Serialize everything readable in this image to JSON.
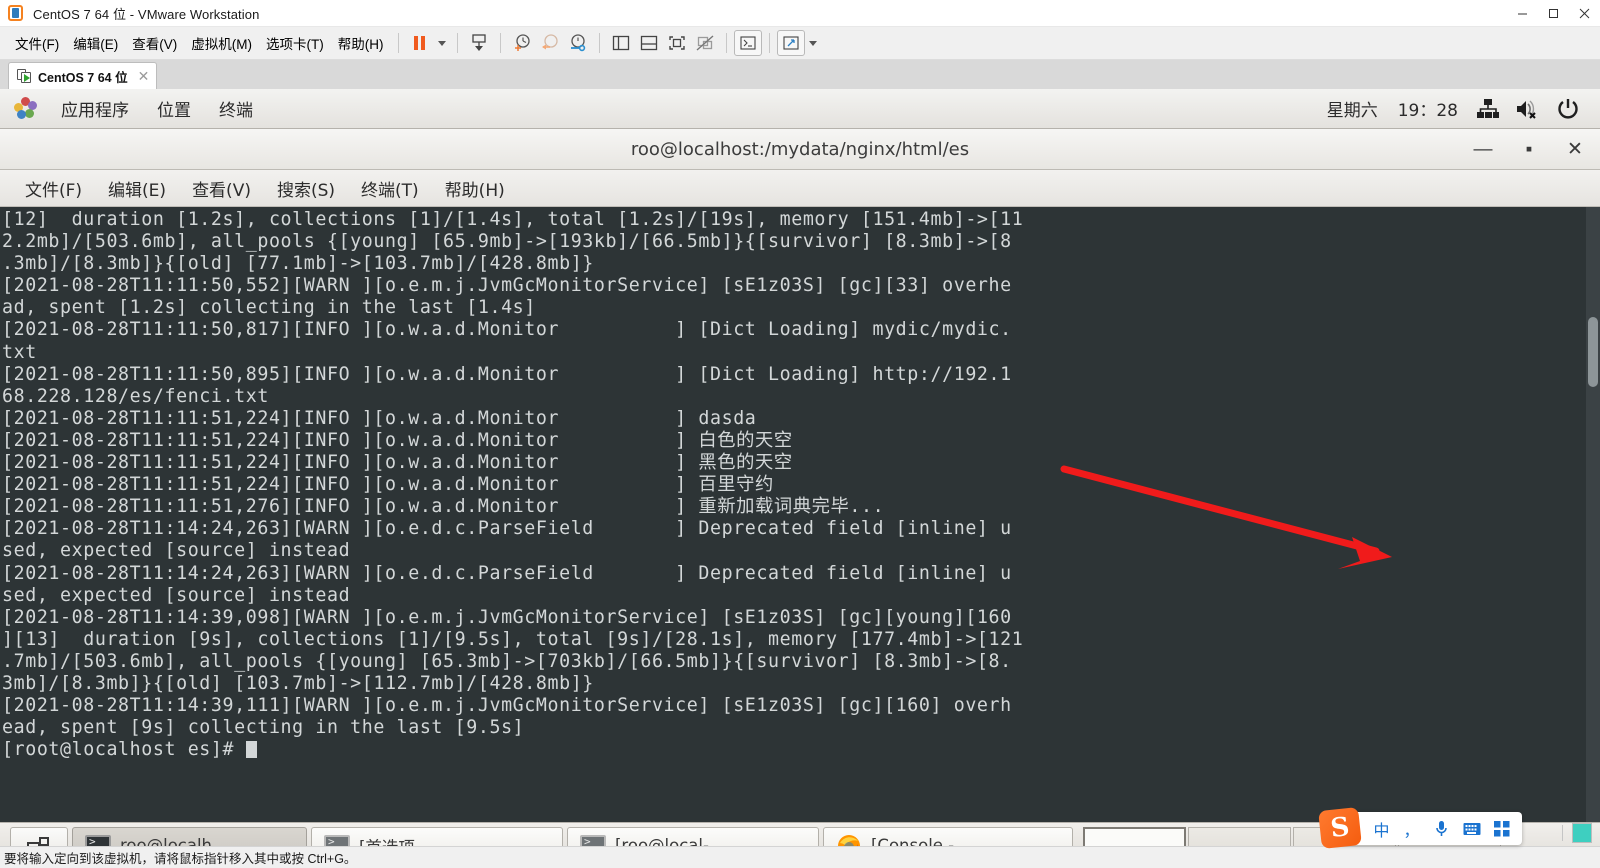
{
  "host": {
    "title": "CentOS 7 64 位 - VMware Workstation",
    "window_controls": {
      "minimize": "–",
      "maximize": "□",
      "close": "✕"
    },
    "menus": [
      "文件(F)",
      "编辑(E)",
      "查看(V)",
      "虚拟机(M)",
      "选项卡(T)",
      "帮助(H)"
    ],
    "tab": {
      "label": "CentOS 7 64 位",
      "close": "✕"
    },
    "statusbar": "要将输入定向到该虚拟机，请将鼠标指针移入其中或按 Ctrl+G。"
  },
  "guest_panel": {
    "applications": "应用程序",
    "places": "位置",
    "terminal": "终端",
    "day": "星期六",
    "time": "19：28"
  },
  "terminal": {
    "title": "roo@localhost:/mydata/nginx/html/es",
    "menus": [
      "文件(F)",
      "编辑(E)",
      "查看(V)",
      "搜索(S)",
      "终端(T)",
      "帮助(H)"
    ],
    "window_buttons": {
      "minimize": "—",
      "maximize": "▪",
      "close": "✕"
    },
    "lines": [
      "[12]  duration [1.2s], collections [1]/[1.4s], total [1.2s]/[19s], memory [151.4mb]->[11",
      "2.2mb]/[503.6mb], all_pools {[young] [65.9mb]->[193kb]/[66.5mb]}{[survivor] [8.3mb]->[8",
      ".3mb]/[8.3mb]}{[old] [77.1mb]->[103.7mb]/[428.8mb]}",
      "[2021-08-28T11:11:50,552][WARN ][o.e.m.j.JvmGcMonitorService] [sE1z03S] [gc][33] overhe",
      "ad, spent [1.2s] collecting in the last [1.4s]",
      "[2021-08-28T11:11:50,817][INFO ][o.w.a.d.Monitor          ] [Dict Loading] mydic/mydic.",
      "txt",
      "[2021-08-28T11:11:50,895][INFO ][o.w.a.d.Monitor          ] [Dict Loading] http://192.1",
      "68.228.128/es/fenci.txt",
      "[2021-08-28T11:11:51,224][INFO ][o.w.a.d.Monitor          ] dasda",
      "[2021-08-28T11:11:51,224][INFO ][o.w.a.d.Monitor          ] 白色的天空",
      "[2021-08-28T11:11:51,224][INFO ][o.w.a.d.Monitor          ] 黑色的天空",
      "[2021-08-28T11:11:51,224][INFO ][o.w.a.d.Monitor          ] 百里守约",
      "[2021-08-28T11:11:51,276][INFO ][o.w.a.d.Monitor          ] 重新加载词典完毕...",
      "[2021-08-28T11:14:24,263][WARN ][o.e.d.c.ParseField       ] Deprecated field [inline] u",
      "sed, expected [source] instead",
      "[2021-08-28T11:14:24,263][WARN ][o.e.d.c.ParseField       ] Deprecated field [inline] u",
      "sed, expected [source] instead",
      "[2021-08-28T11:14:39,098][WARN ][o.e.m.j.JvmGcMonitorService] [sE1z03S] [gc][young][160",
      "][13]  duration [9s], collections [1]/[9.5s], total [9s]/[28.1s], memory [177.4mb]->[121",
      ".7mb]/[503.6mb], all_pools {[young] [65.3mb]->[703kb]/[66.5mb]}{[survivor] [8.3mb]->[8.",
      "3mb]/[8.3mb]}{[old] [103.7mb]->[112.7mb]/[428.8mb]}",
      "[2021-08-28T11:14:39,111][WARN ][o.e.m.j.JvmGcMonitorService] [sE1z03S] [gc][160] overh",
      "ead, spent [9s] collecting in the last [9.5s]"
    ],
    "prompt": "[root@localhost es]# ",
    "colors": {
      "background": "#2d3436",
      "foreground": "#d3d7d8"
    }
  },
  "window_list": [
    {
      "label": "roo@localh…",
      "icon": "terminal-icon",
      "active": true
    },
    {
      "label": "[首选项 —…",
      "icon": "terminal-icon",
      "active": false
    },
    {
      "label": "[roo@local-…",
      "icon": "terminal-icon",
      "active": false
    },
    {
      "label": "[Console - …",
      "icon": "firefox-icon",
      "active": false
    }
  ],
  "workspaces": [
    {
      "name": "workspace-1",
      "active": true
    },
    {
      "name": "workspace-2",
      "active": false
    },
    {
      "name": "workspace-3",
      "active": false
    },
    {
      "name": "workspace-4",
      "active": false
    }
  ],
  "ime": {
    "logo": "S",
    "mode": "中",
    "punctuation": "，",
    "voice": "voice-icon",
    "keyboard": "keyboard-icon",
    "toolbox": "toolbox-icon"
  },
  "annotation": {
    "color": "#f01b1b",
    "shape": "arrow"
  }
}
